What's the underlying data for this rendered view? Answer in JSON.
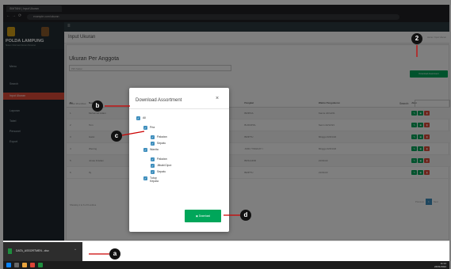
{
  "browser": {
    "tab_title": "SIMTANI | Input Ukuran",
    "address": "example.com/ukuran",
    "nav_symbols": [
      "←",
      "→",
      "⟳"
    ]
  },
  "sidebar": {
    "app_title": "POLDA LAMPUNG",
    "app_subtitle": "Sistem Informasi Ukuran Personel",
    "items": [
      {
        "label": "Menu"
      },
      {
        "label": "Search"
      },
      {
        "label": "Input Ukuran"
      },
      {
        "label": "Laporan"
      },
      {
        "label": "Tabel"
      },
      {
        "label": "Personel"
      },
      {
        "label": "Export"
      }
    ]
  },
  "main": {
    "page_title": "Input Ukuran",
    "breadcrumb": "Home / Input Ukuran",
    "box_title": "Ukuran Per Anggota",
    "select_placeholder": "Pilih Satker",
    "download_all_label": "Download Assortment",
    "show_label": "Show 10 entries",
    "search_label": "Search:",
    "table": {
      "headers": [
        "No",
        "Nama",
        "Pangkat",
        "Jabatan",
        "Pangkat",
        "Waktu Pengukuran",
        "Aksi"
      ],
      "rows": [
        {
          "no": "1",
          "nama": "Muhamad Adam",
          "pangkat": "BRIPDA",
          "jabatan": "BA SIL",
          "pangkat2": "BRIPDA",
          "waktu": "Kamis 22/12/21"
        },
        {
          "no": "2",
          "nama": "Tom",
          "pangkat": "BRIPTU",
          "jabatan": "BA POLRES",
          "pangkat2": "BURUPOL",
          "waktu": "Senin 22/12/21"
        },
        {
          "no": "3",
          "nama": "Gatot",
          "pangkat": "BRIPTU",
          "jabatan": "",
          "pangkat2": "BRIPTU",
          "waktu": "Minggu 02/01/22"
        },
        {
          "no": "4",
          "nama": "Wening",
          "pangkat": "BRIPDA",
          "jabatan": "",
          "pangkat2": "JURU TINGKAT I",
          "waktu": "Minggu 02/01/22"
        },
        {
          "no": "5",
          "nama": "Jonas Kristian",
          "pangkat": "BRIPDA",
          "jabatan": "BA SIL",
          "pangkat2": "BRIGADIR",
          "waktu": "21/01/22"
        },
        {
          "no": "6",
          "nama": "Ify",
          "pangkat": "BRIPTU",
          "jabatan": "ANTENNA",
          "pangkat2": "BRIPTU",
          "waktu": "21/01/22"
        }
      ],
      "action_icons": [
        "edit-icon",
        "view-icon",
        "delete-icon"
      ]
    },
    "showing_text": "Showing 1 to 6 of 6 entries",
    "pager": {
      "prev": "Previous",
      "current": "1",
      "next": "Next"
    },
    "footer_left": "Copyright © Polda Lampung. All rights reserved.",
    "footer_right": "Version 1.0"
  },
  "modal": {
    "title": "Download Assortment",
    "close": "×",
    "tree": [
      {
        "label": "All",
        "level": 0
      },
      {
        "label": "Pria",
        "level": 1
      },
      {
        "label": "Pakaian",
        "level": 2
      },
      {
        "label": "Sepatu",
        "level": 2
      },
      {
        "label": "Wanita",
        "level": 1
      },
      {
        "label": "Pakaian",
        "level": 2
      },
      {
        "label": "Jilbab/Ciput",
        "level": 2
      },
      {
        "label": "Sepatu",
        "level": 2
      },
      {
        "label": "Tutup Kepala",
        "level": 1
      }
    ],
    "download_label": "Download"
  },
  "download_bar": {
    "filename": "DATA_ASSORTMEN...xlsx",
    "chevron": "^"
  },
  "taskbar": {
    "time": "11:14",
    "date": "24/01/2022"
  },
  "callouts": [
    "a",
    "b",
    "c",
    "d",
    "2"
  ],
  "colors": {
    "accent_green": "#00a65a",
    "accent_red": "#dd4b39",
    "accent_blue": "#3c8dbc",
    "sidebar": "#1e272e"
  }
}
